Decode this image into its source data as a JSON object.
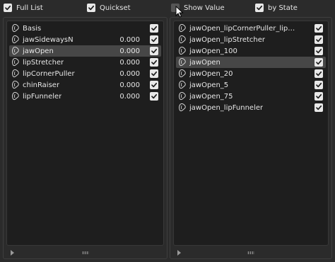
{
  "toolbar": {
    "options": [
      {
        "label": "Full List",
        "checked": true
      },
      {
        "label": "Quickset",
        "checked": true
      },
      {
        "label": "Show Value",
        "checked": false
      },
      {
        "label": "by State",
        "checked": true
      }
    ]
  },
  "left_panel": {
    "items": [
      {
        "name": "Basis",
        "value": "",
        "checked": true,
        "selected": false
      },
      {
        "name": "jawSidewaysN",
        "value": "0.000",
        "checked": true,
        "selected": false
      },
      {
        "name": "jawOpen",
        "value": "0.000",
        "checked": true,
        "selected": true
      },
      {
        "name": "lipStretcher",
        "value": "0.000",
        "checked": true,
        "selected": false
      },
      {
        "name": "lipCornerPuller",
        "value": "0.000",
        "checked": true,
        "selected": false
      },
      {
        "name": "chinRaiser",
        "value": "0.000",
        "checked": true,
        "selected": false
      },
      {
        "name": "lipFunneler",
        "value": "0.000",
        "checked": true,
        "selected": false
      }
    ]
  },
  "right_panel": {
    "items": [
      {
        "name": "jawOpen_lipCornerPuller_lipS...",
        "checked": true,
        "selected": false
      },
      {
        "name": "jawOpen_lipStretcher",
        "checked": true,
        "selected": false
      },
      {
        "name": "jawOpen_100",
        "checked": true,
        "selected": false
      },
      {
        "name": "jawOpen",
        "checked": true,
        "selected": true
      },
      {
        "name": "jawOpen_20",
        "checked": true,
        "selected": false
      },
      {
        "name": "jawOpen_5",
        "checked": true,
        "selected": false
      },
      {
        "name": "jawOpen_75",
        "checked": true,
        "selected": false
      },
      {
        "name": "jawOpen_lipFunneler",
        "checked": true,
        "selected": false
      }
    ]
  },
  "icons": {
    "checkbox": "checkmark-icon",
    "shape_key": "shape-key-icon",
    "expand": "expand-triangle-icon",
    "resize": "resize-grip-icon",
    "cursor": "mouse-pointer-icon"
  },
  "colors": {
    "background": "#2b2b2b",
    "list_background": "#1e1e1e",
    "selected_row": "#474747",
    "checkbox_on": "#e8e8e8",
    "checkbox_off": "#565656"
  }
}
